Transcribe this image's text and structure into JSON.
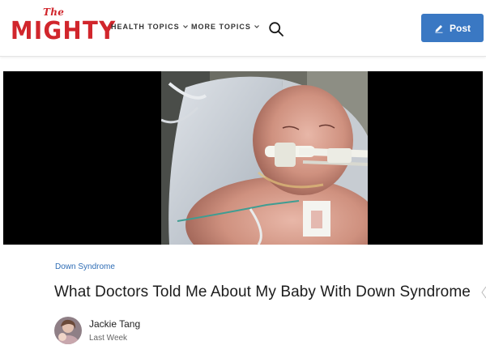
{
  "brand": {
    "logo_small": "The",
    "logo_main": "MIGHTY",
    "accent_color": "#d1262c"
  },
  "nav": {
    "items": [
      {
        "label": "HEALTH TOPICS",
        "icon": "chevron-down-icon"
      },
      {
        "label": "MORE TOPICS",
        "icon": "chevron-down-icon"
      }
    ],
    "search_icon": "search-icon"
  },
  "post_button": {
    "label": "Post",
    "icon": "pencil-icon",
    "color": "#3a78c3"
  },
  "hero": {
    "image": "newborn-baby-in-hospital-photo"
  },
  "article": {
    "category": "Down Syndrome",
    "title": "What Doctors Told Me About My Baby With Down Syndrome",
    "author": "Jackie Tang",
    "date": "Last Week"
  }
}
